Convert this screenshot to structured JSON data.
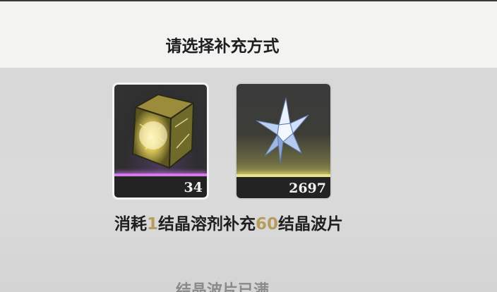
{
  "dialog": {
    "title": "请选择补充方式"
  },
  "items": [
    {
      "name": "solvent",
      "count": "34",
      "rarity_color": "#d27ce8",
      "icon": "crystal-solvent-cube-icon"
    },
    {
      "name": "wave-plate",
      "count": "2697",
      "rarity_color": "#e8e28a",
      "icon": "crystal-wave-star-icon"
    }
  ],
  "description": {
    "part1": "消耗",
    "cost": "1",
    "part2": "结晶溶剂补充",
    "amount": "60",
    "part3": "结晶波片"
  },
  "status": "结晶波片已满",
  "colors": {
    "accent_number": "#b89b5e",
    "header_bg": "#f3f3f1"
  }
}
